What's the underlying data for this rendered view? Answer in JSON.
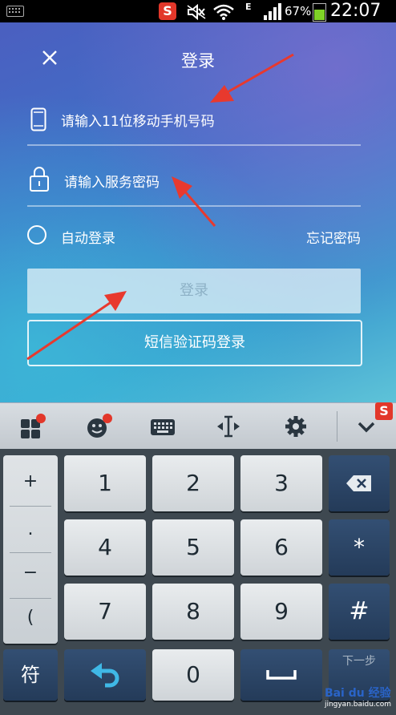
{
  "status_bar": {
    "network_type": "E",
    "battery_percent": "67%",
    "time": "22:07",
    "logo": "S",
    "icons": [
      "keyboard-icon",
      "sogou-icon",
      "mute-icon",
      "wifi-icon",
      "signal-icon",
      "battery-icon"
    ]
  },
  "login": {
    "title": "登录",
    "phone_placeholder": "请输入11位移动手机号码",
    "password_placeholder": "请输入服务密码",
    "auto_login_label": "自动登录",
    "forgot_password": "忘记密码",
    "login_button": "登录",
    "sms_login_button": "短信验证码登录",
    "icons": [
      "close-icon",
      "phone-icon",
      "lock-icon"
    ],
    "colors": {
      "login_button_text": "#8db1c6",
      "arrow": "#e8392e"
    }
  },
  "keyboard": {
    "toolbar_icons": [
      "grid-menu-icon",
      "emoji-icon",
      "keyboard-icon",
      "cursor-icon",
      "settings-icon",
      "collapse-icon"
    ],
    "symbols": [
      "+",
      ".",
      "−",
      "("
    ],
    "digits": [
      "1",
      "2",
      "3",
      "4",
      "5",
      "6",
      "7",
      "8",
      "9",
      "0"
    ],
    "star": "*",
    "hash": "#",
    "sym_key": "符",
    "next_key": "下一步",
    "brand_logo": "S",
    "watermark": "Bai du 经验",
    "watermark_url": "jingyan.baidu.com"
  }
}
